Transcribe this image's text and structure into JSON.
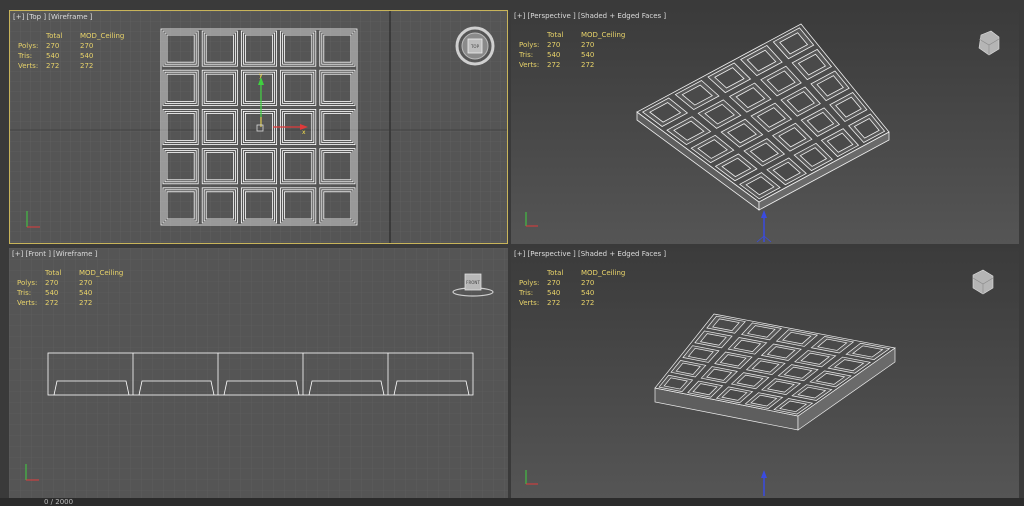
{
  "viewports": {
    "top": {
      "label": "[+] [Top ] [Wireframe ]"
    },
    "persp1": {
      "label": "[+] [Perspective ] [Shaded + Edged Faces ]"
    },
    "front": {
      "label": "[+] [Front ] [Wireframe ]"
    },
    "persp2": {
      "label": "[+] [Perspective ] [Shaded + Edged Faces ]"
    }
  },
  "stats": {
    "header_total": "Total",
    "header_object": "MOD_Ceiling",
    "rows": [
      {
        "label": "Polys:",
        "total": "270",
        "object": "270"
      },
      {
        "label": "Tris:",
        "total": "540",
        "object": "540"
      },
      {
        "label": "Verts:",
        "total": "272",
        "object": "272"
      }
    ]
  },
  "axes": {
    "y_label": "y",
    "x_label": "x"
  },
  "viewcube": {
    "top_face": "TOP",
    "front_face": "FRONT"
  },
  "timeline": {
    "frame": "0 / 2000"
  },
  "colors": {
    "viewport_bg": "#545454",
    "active_border": "#c8b45a",
    "grid_line": "#666666",
    "stats_text": "#e8d36a",
    "wire": "#ffffff"
  }
}
